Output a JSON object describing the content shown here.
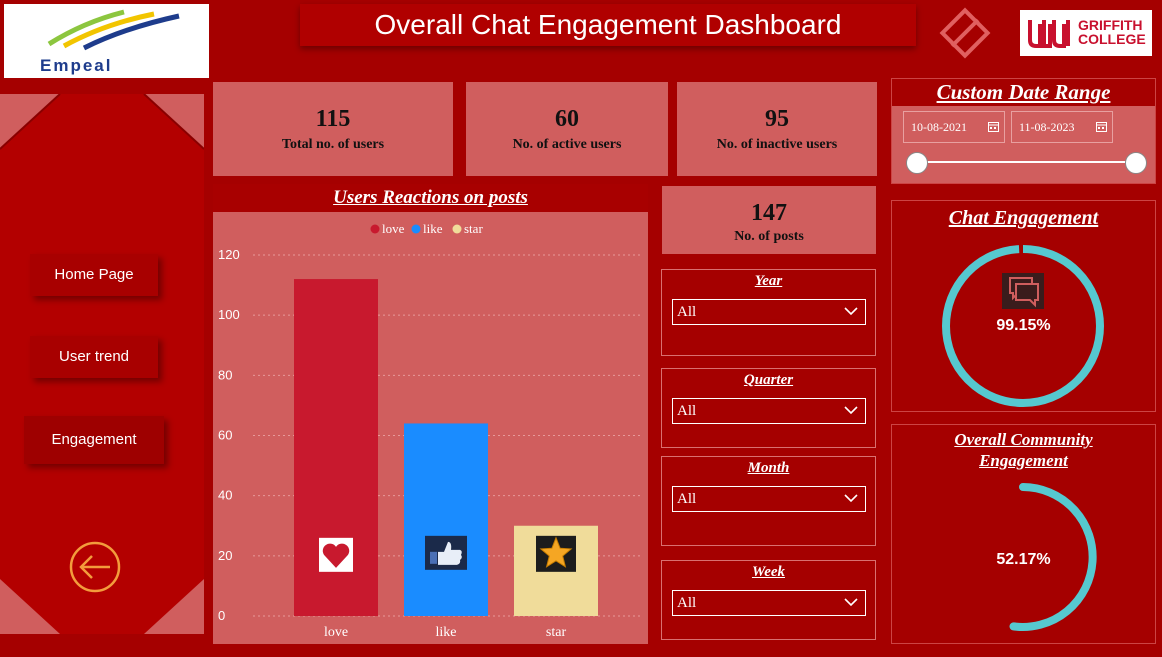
{
  "header": {
    "title": "Overall Chat Engagement Dashboard",
    "logo_left_text": "Empeal",
    "logo_right_text": "GRIFFITH COLLEGE"
  },
  "sidebar": {
    "items": [
      {
        "label": "Home Page"
      },
      {
        "label": "User trend"
      },
      {
        "label": "Engagement"
      }
    ]
  },
  "kpis": [
    {
      "value": "115",
      "label": "Total no. of users"
    },
    {
      "value": "60",
      "label": "No. of active users"
    },
    {
      "value": "95",
      "label": "No. of inactive users"
    },
    {
      "value": "147",
      "label": "No. of posts"
    }
  ],
  "chart_data": {
    "type": "bar",
    "title": "Users Reactions on posts",
    "categories": [
      "love",
      "like",
      "star"
    ],
    "values": [
      112,
      64,
      30
    ],
    "colors": [
      "#c8192e",
      "#1a8cff",
      "#f0dc9a"
    ],
    "legend": [
      "love",
      "like",
      "star"
    ],
    "legend_position": "top",
    "ylim": [
      0,
      120
    ],
    "yticks": [
      0,
      20,
      40,
      60,
      80,
      100,
      120
    ],
    "grid": true,
    "bar_icons": [
      "heart-icon",
      "thumbs-up-icon",
      "star-icon"
    ]
  },
  "filters": [
    {
      "title": "Year",
      "value": "All"
    },
    {
      "title": "Quarter",
      "value": "All"
    },
    {
      "title": "Month",
      "value": "All"
    },
    {
      "title": "Week",
      "value": "All"
    }
  ],
  "date_range": {
    "title": "Custom Date Range",
    "start": "10-08-2021",
    "end": "11-08-2023"
  },
  "chat_engagement": {
    "title": "Chat Engagement",
    "value_label": "99.15%",
    "fraction": 0.9915,
    "ring_color": "#56c8cf"
  },
  "community_engagement": {
    "title_line1": "Overall Community",
    "title_line2": "Engagement",
    "value_label": "52.17%",
    "fraction": 0.5217,
    "ring_color": "#56c8cf"
  }
}
